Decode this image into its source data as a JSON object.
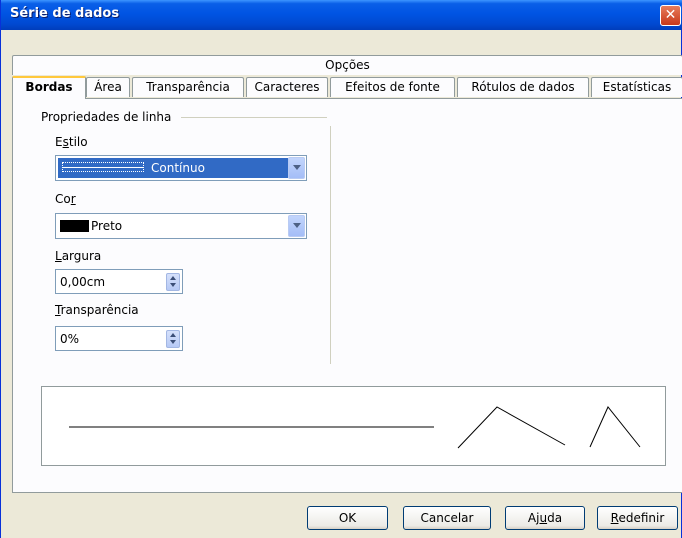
{
  "window": {
    "title": "Série de dados"
  },
  "tabs": {
    "top": [
      "Opções"
    ],
    "bottom": [
      "Bordas",
      "Área",
      "Transparência",
      "Caracteres",
      "Efeitos de fonte",
      "Rótulos de dados",
      "Estatísticas"
    ],
    "active": "Bordas"
  },
  "line_props": {
    "group_title": "Propriedades de linha",
    "style": {
      "label_pre": "E",
      "label_mnemonic": "s",
      "label_post": "tilo",
      "value": "Contínuo"
    },
    "color": {
      "label_pre": "Co",
      "label_mnemonic": "r",
      "label_post": "",
      "value": "Preto",
      "swatch": "#000000"
    },
    "width": {
      "label_pre": "",
      "label_mnemonic": "L",
      "label_post": "argura",
      "value": "0,00cm"
    },
    "transparency": {
      "label_pre": "",
      "label_mnemonic": "T",
      "label_post": "ransparência",
      "value": "0%"
    }
  },
  "buttons": {
    "ok": "OK",
    "cancel": "Cancelar",
    "help_pre": "Aj",
    "help_mnemonic": "u",
    "help_post": "da",
    "reset_pre": "",
    "reset_mnemonic": "R",
    "reset_post": "edefinir"
  },
  "colors": {
    "title_bar": "#0054e3",
    "selection": "#316ac5",
    "active_tab_accent": "#ffc83c"
  }
}
